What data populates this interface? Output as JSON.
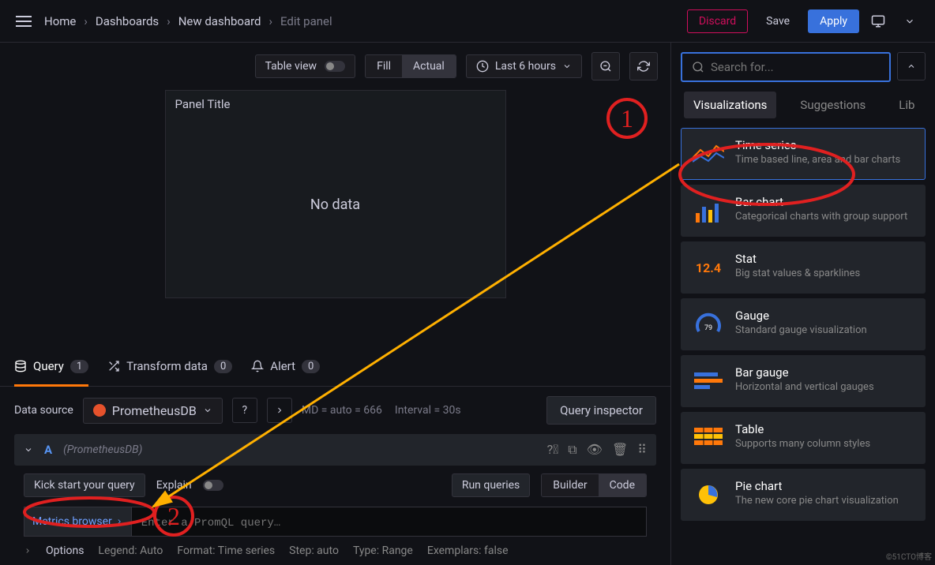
{
  "breadcrumb": {
    "home": "Home",
    "dashboards": "Dashboards",
    "new": "New dashboard",
    "edit": "Edit panel"
  },
  "topbar": {
    "discard": "Discard",
    "save": "Save",
    "apply": "Apply"
  },
  "toolbar": {
    "tableView": "Table view",
    "fill": "Fill",
    "actual": "Actual",
    "timeRange": "Last 6 hours"
  },
  "panel": {
    "title": "Panel Title",
    "noData": "No data"
  },
  "tabs": {
    "query": "Query",
    "queryCount": "1",
    "transform": "Transform data",
    "transformCount": "0",
    "alert": "Alert",
    "alertCount": "0"
  },
  "ds": {
    "label": "Data source",
    "name": "PrometheusDB",
    "md": "MD = auto = 666",
    "interval": "Interval = 30s",
    "inspector": "Query inspector"
  },
  "query": {
    "letter": "A",
    "source": "(PrometheusDB)",
    "kickStart": "Kick start your query",
    "explain": "Explain",
    "run": "Run queries",
    "builder": "Builder",
    "code": "Code",
    "metricsBrowser": "Metrics browser",
    "promqlPlaceholder": "Enter a PromQL query…"
  },
  "options": {
    "label": "Options",
    "legend": "Legend: Auto",
    "format": "Format: Time series",
    "step": "Step: auto",
    "type": "Type: Range",
    "exemplars": "Exemplars: false"
  },
  "right": {
    "searchPlaceholder": "Search for...",
    "tabViz": "Visualizations",
    "tabSug": "Suggestions",
    "tabLib": "Lib"
  },
  "viz": [
    {
      "title": "Time series",
      "desc": "Time based line, area and bar charts"
    },
    {
      "title": "Bar chart",
      "desc": "Categorical charts with group support"
    },
    {
      "title": "Stat",
      "desc": "Big stat values & sparklines"
    },
    {
      "title": "Gauge",
      "desc": "Standard gauge visualization"
    },
    {
      "title": "Bar gauge",
      "desc": "Horizontal and vertical gauges"
    },
    {
      "title": "Table",
      "desc": "Supports many column styles"
    },
    {
      "title": "Pie chart",
      "desc": "The new core pie chart visualization"
    }
  ],
  "annot": {
    "num1": "1",
    "num2": "2",
    "statNum": "12.4",
    "gaugeNum": "79"
  },
  "watermark": "©51CTO博客"
}
